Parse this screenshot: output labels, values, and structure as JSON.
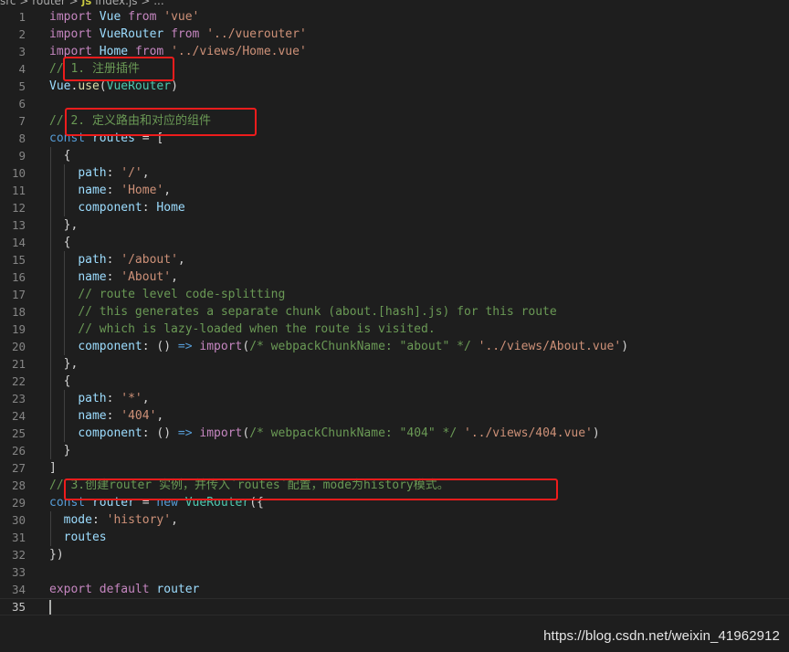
{
  "breadcrumb": {
    "text": "src > router > ",
    "file_icon": "JS",
    "file": "index.js > ..."
  },
  "lines": [
    {
      "n": "1",
      "html": "<span class='k'>import</span> <span class='v'>Vue</span> <span class='k'>from</span> <span class='s'>'vue'</span>"
    },
    {
      "n": "2",
      "html": "<span class='k'>import</span> <span class='v'>VueRouter</span> <span class='k'>from</span> <span class='s'>'../vuerouter'</span>"
    },
    {
      "n": "3",
      "html": "<span class='k'>import</span> <span class='v'>Home</span> <span class='k'>from</span> <span class='s'>'../views/Home.vue'</span>"
    },
    {
      "n": "4",
      "html": "<span class='c'>// 1. <span class='cjk'>注册插件</span></span>"
    },
    {
      "n": "5",
      "html": "<span class='v'>Vue</span>.<span class='f'>use</span>(<span class='t'>VueRouter</span>)"
    },
    {
      "n": "6",
      "html": ""
    },
    {
      "n": "7",
      "html": "<span class='c'>// 2. <span class='cjk'>定义路由和对应的组件</span></span>"
    },
    {
      "n": "8",
      "html": "<span class='kw'>const</span> <span class='v'>routes</span> = ["
    },
    {
      "n": "9",
      "html": "  {"
    },
    {
      "n": "10",
      "html": "    <span class='v'>path</span>: <span class='s'>'/'</span>,"
    },
    {
      "n": "11",
      "html": "    <span class='v'>name</span>: <span class='s'>'Home'</span>,"
    },
    {
      "n": "12",
      "html": "    <span class='v'>component</span>: <span class='v'>Home</span>"
    },
    {
      "n": "13",
      "html": "  },"
    },
    {
      "n": "14",
      "html": "  {"
    },
    {
      "n": "15",
      "html": "    <span class='v'>path</span>: <span class='s'>'/about'</span>,"
    },
    {
      "n": "16",
      "html": "    <span class='v'>name</span>: <span class='s'>'About'</span>,"
    },
    {
      "n": "17",
      "html": "    <span class='c'>// route level code-splitting</span>"
    },
    {
      "n": "18",
      "html": "    <span class='c'>// this generates a separate chunk (about.[hash].js) for this route</span>"
    },
    {
      "n": "19",
      "html": "    <span class='c'>// which is lazy-loaded when the route is visited.</span>"
    },
    {
      "n": "20",
      "html": "    <span class='v'>component</span>: () <span class='kw'>=&gt;</span> <span class='k'>import</span>(<span class='c'>/* webpackChunkName: \"about\" */</span> <span class='s'>'../views/About.vue'</span>)"
    },
    {
      "n": "21",
      "html": "  },"
    },
    {
      "n": "22",
      "html": "  {"
    },
    {
      "n": "23",
      "html": "    <span class='v'>path</span>: <span class='s'>'*'</span>,"
    },
    {
      "n": "24",
      "html": "    <span class='v'>name</span>: <span class='s'>'404'</span>,"
    },
    {
      "n": "25",
      "html": "    <span class='v'>component</span>: () <span class='kw'>=&gt;</span> <span class='k'>import</span>(<span class='c'>/* webpackChunkName: \"404\" */</span> <span class='s'>'../views/404.vue'</span>)"
    },
    {
      "n": "26",
      "html": "  }"
    },
    {
      "n": "27",
      "html": "]"
    },
    {
      "n": "28",
      "html": "<span class='c'>// 3.<span class='cjk'>创建</span>router <span class='cjk'>实例，并传入</span>`routes`<span class='cjk'>配置，</span>mode<span class='cjk'>为</span>history<span class='cjk'>模式。</span></span>"
    },
    {
      "n": "29",
      "html": "<span class='kw'>const</span> <span class='v'>router</span> = <span class='kw'>new</span> <span class='t'>VueRouter</span>({"
    },
    {
      "n": "30",
      "html": "  <span class='v'>mode</span>: <span class='s'>'history'</span>,"
    },
    {
      "n": "31",
      "html": "  <span class='v'>routes</span>"
    },
    {
      "n": "32",
      "html": "})"
    },
    {
      "n": "33",
      "html": ""
    },
    {
      "n": "34",
      "html": "<span class='k'>export</span> <span class='k'>default</span> <span class='v'>router</span>"
    },
    {
      "n": "35",
      "html": "<span class='cursor' data-name='text-cursor' data-interactable='false'></span>"
    }
  ],
  "watermark": "https://blog.csdn.net/weixin_41962912",
  "colors": {
    "background": "#1e1e1e",
    "highlight_box": "#ee1c1c",
    "comment": "#6a9955",
    "string": "#ce9178",
    "keyword": "#c586c0",
    "identifier": "#9cdcfe"
  }
}
